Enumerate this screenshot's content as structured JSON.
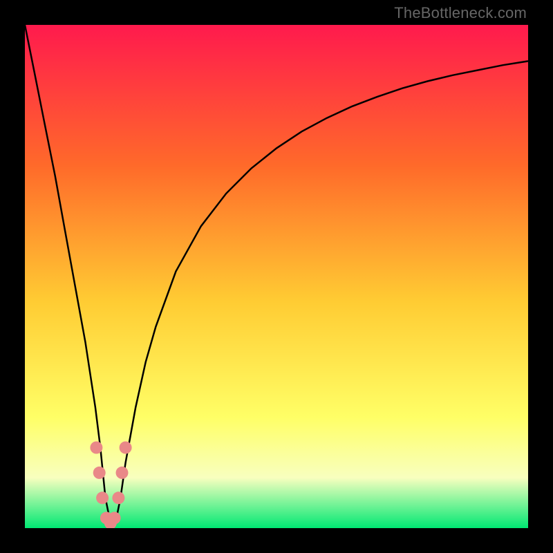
{
  "watermark": "TheBottleneck.com",
  "colors": {
    "top": "#ff1a4d",
    "mid_upper": "#ff6a2a",
    "mid": "#ffcc33",
    "mid_lower": "#ffff66",
    "pale": "#f8ffbf",
    "bottom": "#00e873",
    "curve": "#000000",
    "markers": "#e98888",
    "bg": "#000000"
  },
  "chart_data": {
    "type": "line",
    "title": "",
    "xlabel": "",
    "ylabel": "",
    "xlim": [
      0,
      100
    ],
    "ylim": [
      0,
      100
    ],
    "series": [
      {
        "name": "bottleneck-curve",
        "x": [
          0,
          2,
          4,
          6,
          8,
          10,
          12,
          14,
          15,
          16,
          17,
          18,
          19,
          20,
          22,
          24,
          26,
          30,
          35,
          40,
          45,
          50,
          55,
          60,
          65,
          70,
          75,
          80,
          85,
          90,
          95,
          100
        ],
        "values": [
          100,
          90,
          80,
          70,
          59,
          48,
          37,
          24,
          16,
          6,
          1,
          1,
          6,
          13,
          24,
          33,
          40,
          51,
          60,
          66.5,
          71.5,
          75.5,
          78.8,
          81.5,
          83.8,
          85.7,
          87.4,
          88.8,
          90,
          91,
          92,
          92.8
        ]
      }
    ],
    "markers": [
      {
        "x": 14.2,
        "y": 16
      },
      {
        "x": 14.8,
        "y": 11
      },
      {
        "x": 15.4,
        "y": 6
      },
      {
        "x": 16.2,
        "y": 2
      },
      {
        "x": 17.0,
        "y": 1
      },
      {
        "x": 17.8,
        "y": 2
      },
      {
        "x": 18.6,
        "y": 6
      },
      {
        "x": 19.3,
        "y": 11
      },
      {
        "x": 20.0,
        "y": 16
      }
    ],
    "annotations": []
  }
}
